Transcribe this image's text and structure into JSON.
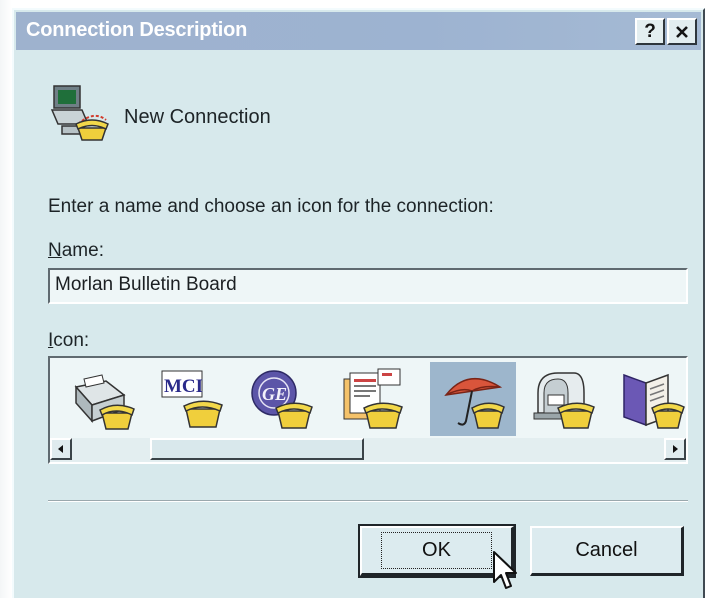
{
  "window": {
    "title": "Connection Description",
    "help_symbol": "?",
    "close_symbol": "✕"
  },
  "connection": {
    "icon": "phone-computer-icon",
    "name": "New Connection"
  },
  "form": {
    "prompt": "Enter a name and choose an icon for the connection:",
    "name_label_accel": "N",
    "name_label_rest": "ame:",
    "name_value": "Morlan Bulletin Board",
    "icon_label_accel": "I",
    "icon_label_rest": "con:"
  },
  "icons": [
    {
      "name": "fax-phone-icon",
      "selected": false
    },
    {
      "name": "mci-phone-icon",
      "text": "MCI",
      "selected": false
    },
    {
      "name": "ge-phone-icon",
      "text": "GE",
      "selected": false
    },
    {
      "name": "documents-phone-icon",
      "selected": false
    },
    {
      "name": "umbrella-phone-icon",
      "selected": true
    },
    {
      "name": "mailbox-phone-icon",
      "selected": false
    },
    {
      "name": "book-phone-icon",
      "selected": false
    }
  ],
  "buttons": {
    "ok": "OK",
    "cancel": "Cancel"
  },
  "colors": {
    "dialog_bg": "#d7e9ec",
    "titlebar": "#9eb2ce",
    "selection": "#9db6cc"
  }
}
